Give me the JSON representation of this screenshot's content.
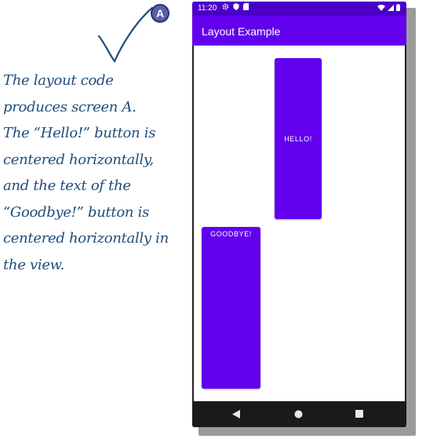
{
  "annotation": {
    "badge": "A",
    "lines": [
      "The layout code",
      "produces screen A.",
      "The “Hello!” button is",
      "centered horizontally,",
      "and the text of the",
      "“Goodbye!” button is",
      "centered horizontally in",
      "the view."
    ],
    "ink_color": "#1f4d7a"
  },
  "phone": {
    "status": {
      "time": "11:20"
    },
    "appbar": {
      "title": "Layout Example"
    },
    "buttons": {
      "hello": "HELLO!",
      "goodbye": "GOODBYE!"
    },
    "colors": {
      "primary": "#6200ee",
      "primary_dark": "#4b00c8",
      "navbar": "#1a1a1a"
    },
    "navbar": [
      "back-icon",
      "home-icon",
      "recents-icon"
    ]
  }
}
